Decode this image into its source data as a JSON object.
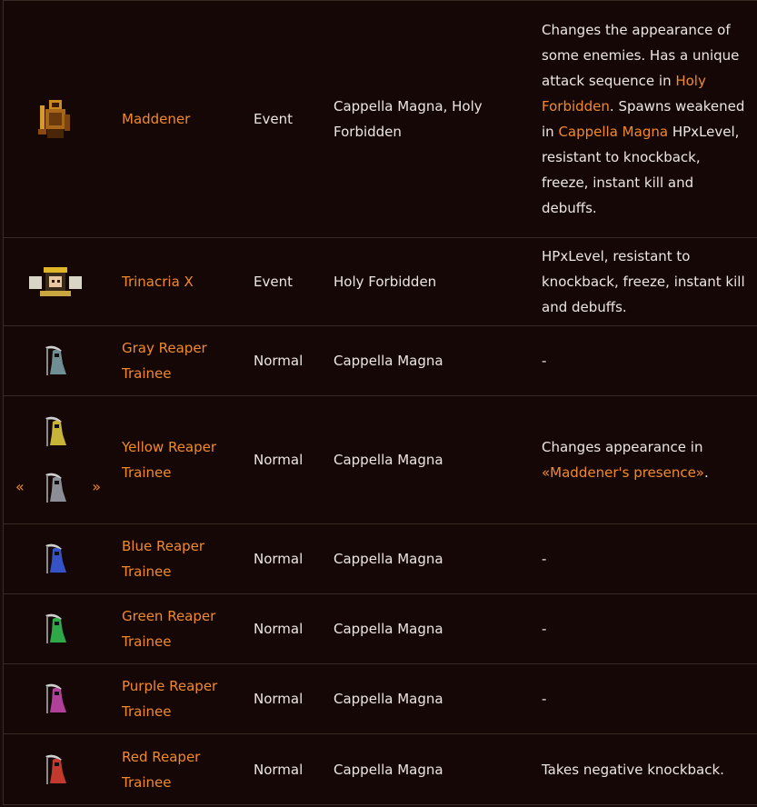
{
  "rows": [
    {
      "name": "Maddener",
      "type": "Event",
      "stage": "Cappella Magna, Holy Forbidden",
      "notes": {
        "t1": "Changes the appearance of some enemies. Has a unique attack sequence in ",
        "l1": "Holy Forbidden",
        "t2": ". Spawns weakened in ",
        "l2": "Cappella Magna",
        "t3": " HPxLevel, resistant to knockback, freeze, instant kill and debuffs."
      },
      "icon": "maddener-sprite-icon"
    },
    {
      "name": "Trinacria X",
      "type": "Event",
      "stage": "Holy Forbidden",
      "notes": "HPxLevel, resistant to knockback, freeze, instant kill and debuffs.",
      "icon": "trinacria-sprite-icon"
    },
    {
      "name": "Gray Reaper Trainee",
      "type": "Normal",
      "stage": "Cappella Magna",
      "notes": "-",
      "color": "#6f8f95"
    },
    {
      "name": "Yellow Reaper Trainee",
      "type": "Normal",
      "stage": "Cappella Magna",
      "notes": {
        "t1": "Changes appearance in ",
        "l1": "«Maddener's presence»",
        "t2": "."
      },
      "color": "#c9b43a",
      "alt_color": "#8b8f95",
      "prev_arrow": "«",
      "next_arrow": "»"
    },
    {
      "name": "Blue Reaper Trainee",
      "type": "Normal",
      "stage": "Cappella Magna",
      "notes": "-",
      "color": "#3553c7"
    },
    {
      "name": "Green Reaper Trainee",
      "type": "Normal",
      "stage": "Cappella Magna",
      "notes": "-",
      "color": "#2fa84a"
    },
    {
      "name": "Purple Reaper Trainee",
      "type": "Normal",
      "stage": "Cappella Magna",
      "notes": "-",
      "color": "#b0409a"
    },
    {
      "name": "Red Reaper Trainee",
      "type": "Normal",
      "stage": "Cappella Magna",
      "notes": "Takes negative knockback.",
      "color": "#c23a2e"
    }
  ],
  "colors": {
    "link": "#f08a2a",
    "text": "#ece6e0",
    "background": "#160707",
    "border": "#3a2a26"
  }
}
